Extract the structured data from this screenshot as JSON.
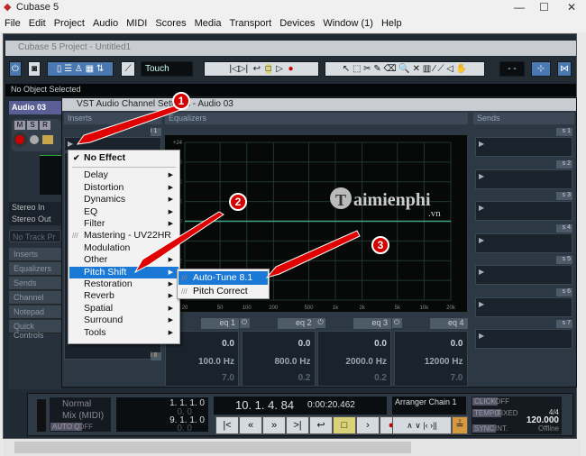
{
  "app": {
    "title": "Cubase 5",
    "menu": [
      "File",
      "Edit",
      "Project",
      "Audio",
      "MIDI",
      "Scores",
      "Media",
      "Transport",
      "Devices",
      "Window (1)",
      "Help"
    ]
  },
  "project": {
    "title": "Cubase 5 Project - Untitled1",
    "automation_mode": "Touch",
    "status": "No Object Selected"
  },
  "inspector": {
    "track": "Audio 03",
    "buttons": [
      "M",
      "S",
      "R"
    ],
    "input": "Stereo In",
    "output": "Stereo Out",
    "preset_placeholder": "No Track Pr",
    "sections": [
      "Inserts",
      "Equalizers",
      "Sends",
      "Channel",
      "Notepad",
      "Quick Controls"
    ]
  },
  "dialog": {
    "title": "VST Audio Channel Settings - Audio 03",
    "inserts_label": "Inserts",
    "eq_label": "Equalizers",
    "sends_label": "Sends",
    "slot_first": "i 1",
    "slot_last": "i 8",
    "eq_y_ticks": [
      "+24",
      "18",
      "12",
      "6",
      "0",
      "-12"
    ],
    "eq_x_ticks": [
      "20",
      "50",
      "100",
      "200",
      "500",
      "1k",
      "2k",
      "5k",
      "10k",
      "20k"
    ],
    "bands": [
      {
        "label": "eq 1",
        "gain": "0.0",
        "freq": "100.0 Hz",
        "q": "7.0"
      },
      {
        "label": "eq 2",
        "gain": "0.0",
        "freq": "800.0 Hz",
        "q": "0.2"
      },
      {
        "label": "eq 3",
        "gain": "0.0",
        "freq": "2000.0 Hz",
        "q": "0.2"
      },
      {
        "label": "eq 4",
        "gain": "0.0",
        "freq": "12000 Hz",
        "q": "7.0"
      }
    ],
    "sends": [
      "s 1",
      "s 2",
      "s 3",
      "s 4",
      "s 5",
      "s 6",
      "s 7"
    ]
  },
  "context_menu": {
    "items": [
      {
        "label": "No Effect",
        "checked": true
      },
      {
        "label": "Delay",
        "sub": true
      },
      {
        "label": "Distortion",
        "sub": true
      },
      {
        "label": "Dynamics",
        "sub": true
      },
      {
        "label": "EQ",
        "sub": true
      },
      {
        "label": "Filter",
        "sub": true
      },
      {
        "label": "Mastering - UV22HR",
        "plugin": true
      },
      {
        "label": "Modulation"
      },
      {
        "label": "Other",
        "sub": true
      },
      {
        "label": "Pitch Shift",
        "sub": true,
        "selected": true
      },
      {
        "label": "Restoration",
        "sub": true
      },
      {
        "label": "Reverb",
        "sub": true
      },
      {
        "label": "Spatial",
        "sub": true
      },
      {
        "label": "Surround",
        "sub": true
      },
      {
        "label": "Tools",
        "sub": true
      }
    ],
    "submenu": [
      {
        "label": "Auto-Tune 8.1",
        "selected": true
      },
      {
        "label": "Pitch Correct"
      }
    ]
  },
  "transport": {
    "mode1": "Normal",
    "mode2": "Mix (MIDI)",
    "auto_q": "AUTO Q",
    "auto_q_val": "OFF",
    "left_locator": "1. 1. 1.   0",
    "right_locator": "9. 1. 1.   0",
    "sub1": "0.   0",
    "sub2": "0.   0",
    "position": "10. 1. 4. 84",
    "time": "0:00:20.462",
    "arranger": "Arranger Chain 1",
    "click": "CLICK",
    "click_val": "OFF",
    "tempo": "TEMPO",
    "tempo_mode": "FIXED",
    "signature": "4/4",
    "bpm": "120.000",
    "sync": "SYNC",
    "sync_mode": "INT.",
    "sync_state": "Offline"
  },
  "watermark": {
    "text": "Taimienphi",
    ".vn": ".vn"
  },
  "annotations": [
    "1",
    "2",
    "3"
  ],
  "colors": {
    "accent": "#1a78d6",
    "arrow": "#e00000",
    "eq_line": "#3fa58a"
  }
}
